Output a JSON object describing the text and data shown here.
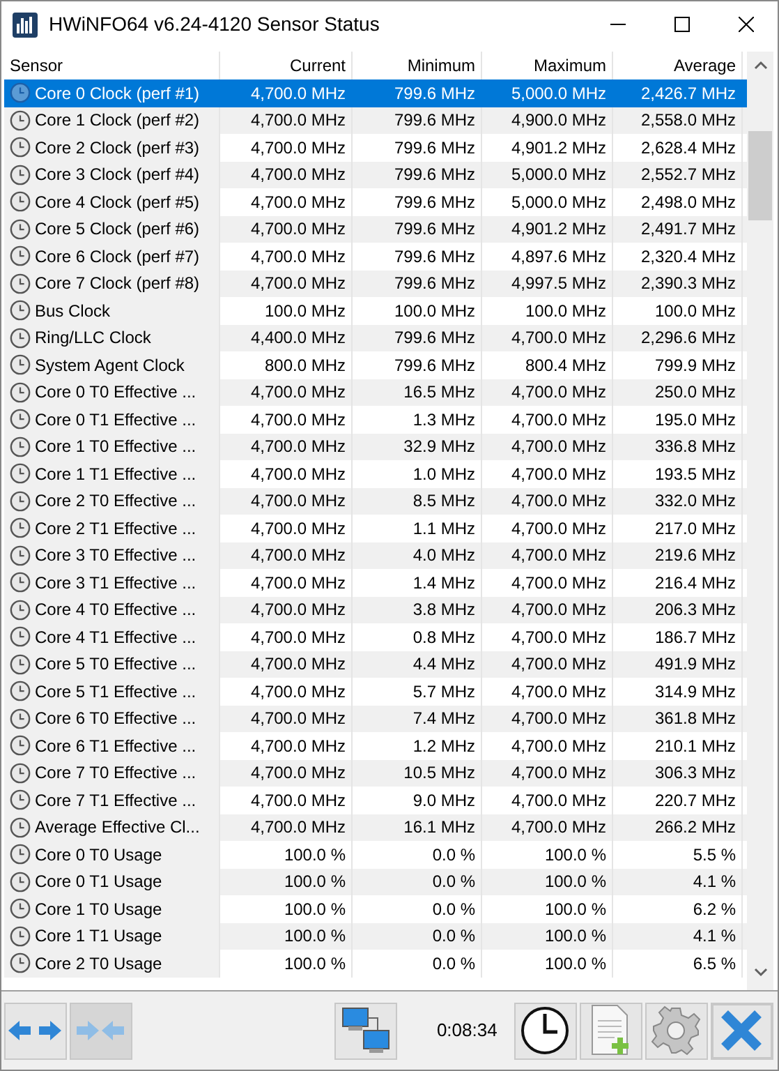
{
  "window": {
    "title": "HWiNFO64 v6.24-4120 Sensor Status"
  },
  "table": {
    "columns": [
      "Sensor",
      "Current",
      "Minimum",
      "Maximum",
      "Average"
    ],
    "rows": [
      {
        "cells": [
          "Core 0 Clock (perf #1)",
          "4,700.0 MHz",
          "799.6 MHz",
          "5,000.0 MHz",
          "2,426.7 MHz"
        ],
        "selected": true
      },
      {
        "cells": [
          "Core 1 Clock (perf #2)",
          "4,700.0 MHz",
          "799.6 MHz",
          "4,900.0 MHz",
          "2,558.0 MHz"
        ],
        "selected": false
      },
      {
        "cells": [
          "Core 2 Clock (perf #3)",
          "4,700.0 MHz",
          "799.6 MHz",
          "4,901.2 MHz",
          "2,628.4 MHz"
        ],
        "selected": false
      },
      {
        "cells": [
          "Core 3 Clock (perf #4)",
          "4,700.0 MHz",
          "799.6 MHz",
          "5,000.0 MHz",
          "2,552.7 MHz"
        ],
        "selected": false
      },
      {
        "cells": [
          "Core 4 Clock (perf #5)",
          "4,700.0 MHz",
          "799.6 MHz",
          "5,000.0 MHz",
          "2,498.0 MHz"
        ],
        "selected": false
      },
      {
        "cells": [
          "Core 5 Clock (perf #6)",
          "4,700.0 MHz",
          "799.6 MHz",
          "4,901.2 MHz",
          "2,491.7 MHz"
        ],
        "selected": false
      },
      {
        "cells": [
          "Core 6 Clock (perf #7)",
          "4,700.0 MHz",
          "799.6 MHz",
          "4,897.6 MHz",
          "2,320.4 MHz"
        ],
        "selected": false
      },
      {
        "cells": [
          "Core 7 Clock (perf #8)",
          "4,700.0 MHz",
          "799.6 MHz",
          "4,997.5 MHz",
          "2,390.3 MHz"
        ],
        "selected": false
      },
      {
        "cells": [
          "Bus Clock",
          "100.0 MHz",
          "100.0 MHz",
          "100.0 MHz",
          "100.0 MHz"
        ],
        "selected": false
      },
      {
        "cells": [
          "Ring/LLC Clock",
          "4,400.0 MHz",
          "799.6 MHz",
          "4,700.0 MHz",
          "2,296.6 MHz"
        ],
        "selected": false
      },
      {
        "cells": [
          "System Agent Clock",
          "800.0 MHz",
          "799.6 MHz",
          "800.4 MHz",
          "799.9 MHz"
        ],
        "selected": false
      },
      {
        "cells": [
          "Core 0 T0 Effective ...",
          "4,700.0 MHz",
          "16.5 MHz",
          "4,700.0 MHz",
          "250.0 MHz"
        ],
        "selected": false
      },
      {
        "cells": [
          "Core 0 T1 Effective ...",
          "4,700.0 MHz",
          "1.3 MHz",
          "4,700.0 MHz",
          "195.0 MHz"
        ],
        "selected": false
      },
      {
        "cells": [
          "Core 1 T0 Effective ...",
          "4,700.0 MHz",
          "32.9 MHz",
          "4,700.0 MHz",
          "336.8 MHz"
        ],
        "selected": false
      },
      {
        "cells": [
          "Core 1 T1 Effective ...",
          "4,700.0 MHz",
          "1.0 MHz",
          "4,700.0 MHz",
          "193.5 MHz"
        ],
        "selected": false
      },
      {
        "cells": [
          "Core 2 T0 Effective ...",
          "4,700.0 MHz",
          "8.5 MHz",
          "4,700.0 MHz",
          "332.0 MHz"
        ],
        "selected": false
      },
      {
        "cells": [
          "Core 2 T1 Effective ...",
          "4,700.0 MHz",
          "1.1 MHz",
          "4,700.0 MHz",
          "217.0 MHz"
        ],
        "selected": false
      },
      {
        "cells": [
          "Core 3 T0 Effective ...",
          "4,700.0 MHz",
          "4.0 MHz",
          "4,700.0 MHz",
          "219.6 MHz"
        ],
        "selected": false
      },
      {
        "cells": [
          "Core 3 T1 Effective ...",
          "4,700.0 MHz",
          "1.4 MHz",
          "4,700.0 MHz",
          "216.4 MHz"
        ],
        "selected": false
      },
      {
        "cells": [
          "Core 4 T0 Effective ...",
          "4,700.0 MHz",
          "3.8 MHz",
          "4,700.0 MHz",
          "206.3 MHz"
        ],
        "selected": false
      },
      {
        "cells": [
          "Core 4 T1 Effective ...",
          "4,700.0 MHz",
          "0.8 MHz",
          "4,700.0 MHz",
          "186.7 MHz"
        ],
        "selected": false
      },
      {
        "cells": [
          "Core 5 T0 Effective ...",
          "4,700.0 MHz",
          "4.4 MHz",
          "4,700.0 MHz",
          "491.9 MHz"
        ],
        "selected": false
      },
      {
        "cells": [
          "Core 5 T1 Effective ...",
          "4,700.0 MHz",
          "5.7 MHz",
          "4,700.0 MHz",
          "314.9 MHz"
        ],
        "selected": false
      },
      {
        "cells": [
          "Core 6 T0 Effective ...",
          "4,700.0 MHz",
          "7.4 MHz",
          "4,700.0 MHz",
          "361.8 MHz"
        ],
        "selected": false
      },
      {
        "cells": [
          "Core 6 T1 Effective ...",
          "4,700.0 MHz",
          "1.2 MHz",
          "4,700.0 MHz",
          "210.1 MHz"
        ],
        "selected": false
      },
      {
        "cells": [
          "Core 7 T0 Effective ...",
          "4,700.0 MHz",
          "10.5 MHz",
          "4,700.0 MHz",
          "306.3 MHz"
        ],
        "selected": false
      },
      {
        "cells": [
          "Core 7 T1 Effective ...",
          "4,700.0 MHz",
          "9.0 MHz",
          "4,700.0 MHz",
          "220.7 MHz"
        ],
        "selected": false
      },
      {
        "cells": [
          "Average Effective Cl...",
          "4,700.0 MHz",
          "16.1 MHz",
          "4,700.0 MHz",
          "266.2 MHz"
        ],
        "selected": false
      },
      {
        "cells": [
          "Core 0 T0 Usage",
          "100.0 %",
          "0.0 %",
          "100.0 %",
          "5.5 %"
        ],
        "selected": false
      },
      {
        "cells": [
          "Core 0 T1 Usage",
          "100.0 %",
          "0.0 %",
          "100.0 %",
          "4.1 %"
        ],
        "selected": false
      },
      {
        "cells": [
          "Core 1 T0 Usage",
          "100.0 %",
          "0.0 %",
          "100.0 %",
          "6.2 %"
        ],
        "selected": false
      },
      {
        "cells": [
          "Core 1 T1 Usage",
          "100.0 %",
          "0.0 %",
          "100.0 %",
          "4.1 %"
        ],
        "selected": false
      },
      {
        "cells": [
          "Core 2 T0 Usage",
          "100.0 %",
          "0.0 %",
          "100.0 %",
          "6.5 %"
        ],
        "selected": false
      }
    ]
  },
  "toolbar": {
    "timer": "0:08:34"
  }
}
